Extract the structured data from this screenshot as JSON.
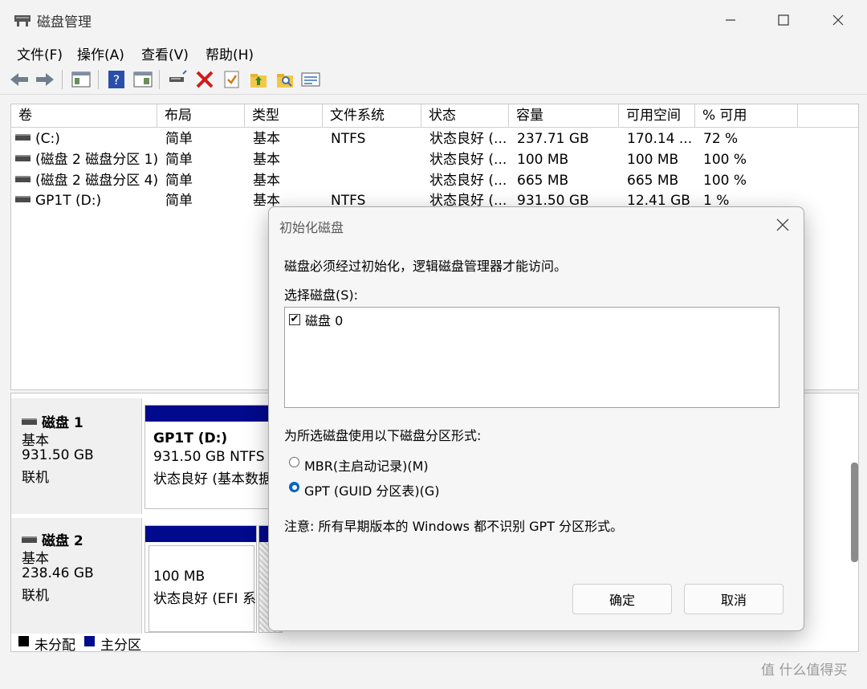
{
  "window": {
    "title": "磁盘管理"
  },
  "menu": [
    "文件(F)",
    "操作(A)",
    "查看(V)",
    "帮助(H)"
  ],
  "toolbar": {
    "icons": [
      "back-icon",
      "forward-icon",
      "show-hide-console-tree-icon",
      "help-icon",
      "properties-icon",
      "connect-icon",
      "delete-icon",
      "check-icon",
      "up-folder-icon",
      "search-folder-icon",
      "list-view-icon"
    ]
  },
  "volume_list": {
    "headers": [
      "卷",
      "布局",
      "类型",
      "文件系统",
      "状态",
      "容量",
      "可用空间",
      "% 可用"
    ],
    "rows": [
      [
        "(C:)",
        "简单",
        "基本",
        "NTFS",
        "状态良好 (...",
        "237.71 GB",
        "170.14 ...",
        "72 %"
      ],
      [
        "(磁盘 2 磁盘分区 1)",
        "简单",
        "基本",
        "",
        "状态良好 (...",
        "100 MB",
        "100 MB",
        "100 %"
      ],
      [
        "(磁盘 2 磁盘分区 4)",
        "简单",
        "基本",
        "",
        "状态良好 (...",
        "665 MB",
        "665 MB",
        "100 %"
      ],
      [
        "GP1T (D:)",
        "简单",
        "基本",
        "NTFS",
        "状态良好 (...",
        "931.50 GB",
        "12.41 GB",
        "1 %"
      ]
    ]
  },
  "disks": [
    {
      "name": "磁盘 1",
      "type": "基本",
      "size": "931.50 GB",
      "status": "联机",
      "partition": {
        "title": "GP1T  (D:)",
        "size": "931.50 GB NTFS",
        "status": "状态良好 (基本数据"
      }
    },
    {
      "name": "磁盘 2",
      "type": "基本",
      "size": "238.46 GB",
      "status": "联机",
      "partition": {
        "size": "100 MB",
        "status": "状态良好 (EFI 系"
      }
    }
  ],
  "legend": {
    "unallocated": "未分配",
    "primary": "主分区"
  },
  "dialog": {
    "title": "初始化磁盘",
    "message": "磁盘必须经过初始化，逻辑磁盘管理器才能访问。",
    "select_label": "选择磁盘(S):",
    "disk_item": "磁盘 0",
    "disk_checked": true,
    "style_label": "为所选磁盘使用以下磁盘分区形式:",
    "option_mbr": "MBR(主启动记录)(M)",
    "option_gpt": "GPT (GUID 分区表)(G)",
    "selected": "GPT",
    "note": "注意: 所有早期版本的 Windows 都不识别 GPT 分区形式。",
    "ok": "确定",
    "cancel": "取消"
  },
  "colors": {
    "primary_partition": "#000a8c",
    "unallocated": "#000000",
    "accent": "#0067c0"
  },
  "watermark": "值 什么值得买"
}
